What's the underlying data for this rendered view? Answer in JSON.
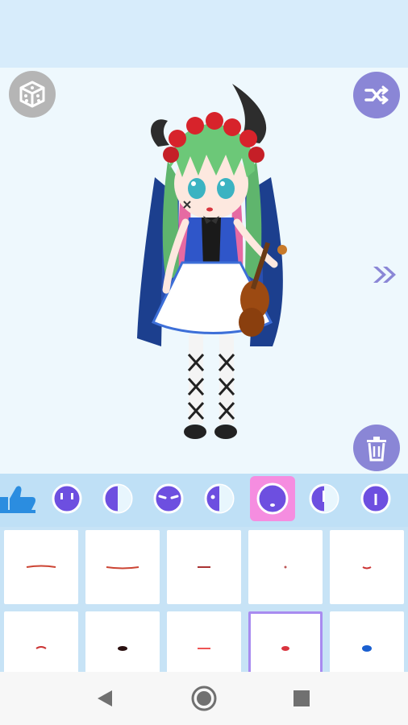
{
  "toolbar": {
    "dice_icon": "dice-icon",
    "shuffle_icon": "shuffle-icon",
    "next_icon": "double-chevron-right-icon",
    "trash_icon": "trash-icon"
  },
  "categories": {
    "items": [
      {
        "icon": "thumbs-up-icon"
      },
      {
        "icon": "face-eyes-icon"
      },
      {
        "icon": "face-half-icon"
      },
      {
        "icon": "face-closed-eyes-icon"
      },
      {
        "icon": "face-left-eye-icon"
      },
      {
        "icon": "face-mouth-icon",
        "selected": true
      },
      {
        "icon": "face-blush-icon"
      },
      {
        "icon": "face-line-icon"
      }
    ]
  },
  "mouth_options": {
    "rows": 2,
    "columns": 5,
    "selected_index": 8
  },
  "colors": {
    "accent": "#8a86d6",
    "selected_category": "#f58de0",
    "selected_tile_border": "#a88bf0",
    "top_bar": "#d7ecfb",
    "stage": "#eef8fd"
  },
  "system_nav": {
    "back_icon": "back-triangle-icon",
    "home_icon": "home-circle-icon",
    "recents_icon": "recents-square-icon"
  }
}
